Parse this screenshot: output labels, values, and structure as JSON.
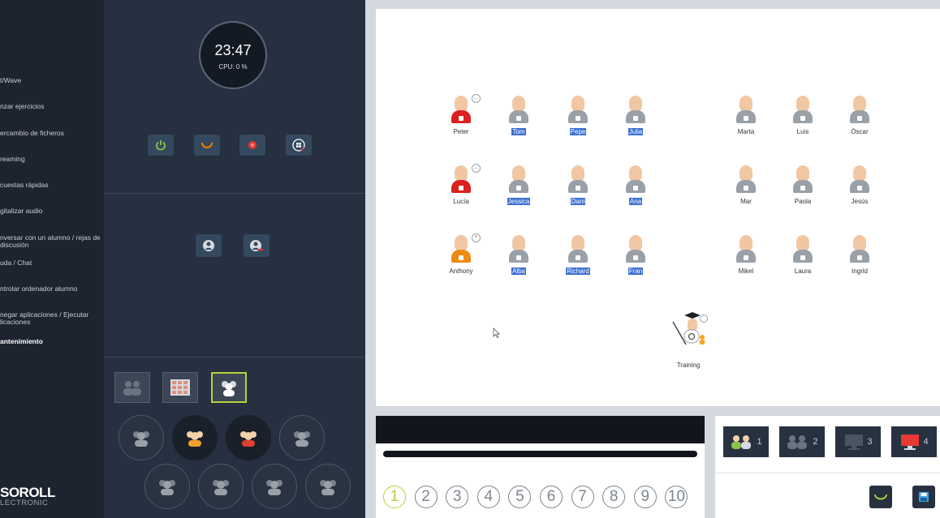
{
  "sidebar": {
    "items": [
      {
        "label": "t/Wave"
      },
      {
        "label": "nzar ejercicios"
      },
      {
        "label": "ercambio de ficheros"
      },
      {
        "label": "reaming"
      },
      {
        "label": "cuestas rápidas"
      },
      {
        "label": "gitalizar audio"
      },
      {
        "label": "nversar con un alumno / rejas de discusión"
      },
      {
        "label": "uda / Chat"
      },
      {
        "label": "ntrolar ordenador alumno"
      },
      {
        "label": "negar aplicaciones / Ejecutar licaciones"
      },
      {
        "label": "antenimiento"
      }
    ],
    "active_index": 10,
    "brand": {
      "name": "SOROLL",
      "sub": "LECTRONIC"
    }
  },
  "panel": {
    "clock": {
      "time": "23:47",
      "cpu": "CPU: 0 %"
    },
    "power_buttons": [
      {
        "icon": "power-icon",
        "color": "#8bc34a"
      },
      {
        "icon": "restart-icon",
        "color": "#f57c00"
      },
      {
        "icon": "record-stop-icon",
        "color": "#e53935"
      },
      {
        "icon": "windows-logoff-icon",
        "color": "#ffffff"
      }
    ],
    "user_buttons": [
      {
        "icon": "student-icon"
      },
      {
        "icon": "student-disconnect-icon"
      }
    ],
    "view_modes": [
      {
        "icon": "group-view-icon",
        "selected": false
      },
      {
        "icon": "grid-view-icon",
        "selected": false
      },
      {
        "icon": "class-view-icon",
        "selected": true
      }
    ],
    "group_circles_row1": [
      {
        "icon": "group-icon",
        "color": "#7a828c"
      },
      {
        "icon": "group-icon",
        "color": "#f0a030"
      },
      {
        "icon": "group-icon",
        "color": "#e04030"
      },
      {
        "icon": "group-icon",
        "color": "#7a828c"
      }
    ],
    "group_circles_row2": [
      {
        "icon": "group-icon",
        "color": "#7a828c"
      },
      {
        "icon": "group-icon",
        "color": "#7a828c"
      },
      {
        "icon": "group-icon",
        "color": "#7a828c"
      },
      {
        "icon": "group-icon",
        "color": "#7a828c"
      }
    ]
  },
  "map": {
    "students": [
      {
        "name": "Peter",
        "state": "red",
        "highlight": false,
        "bubble": "chat"
      },
      {
        "name": "Tom",
        "state": "grey",
        "highlight": true
      },
      {
        "name": "Pepe",
        "state": "grey",
        "highlight": true
      },
      {
        "name": "Julia",
        "state": "grey",
        "highlight": true
      },
      {
        "name": "Marta",
        "state": "grey",
        "highlight": false
      },
      {
        "name": "Luis",
        "state": "grey",
        "highlight": false
      },
      {
        "name": "Óscar",
        "state": "grey",
        "highlight": false
      },
      {
        "name": "Lucía",
        "state": "red",
        "highlight": false,
        "bubble": "chat"
      },
      {
        "name": "Jessica",
        "state": "grey",
        "highlight": true
      },
      {
        "name": "Dani",
        "state": "grey",
        "highlight": true
      },
      {
        "name": "Ana",
        "state": "grey",
        "highlight": true
      },
      {
        "name": "Mar",
        "state": "grey",
        "highlight": false
      },
      {
        "name": "Paola",
        "state": "grey",
        "highlight": false
      },
      {
        "name": "Jesús",
        "state": "grey",
        "highlight": false
      },
      {
        "name": "Anthony",
        "state": "orange",
        "highlight": false,
        "bubble": "close"
      },
      {
        "name": "Alba",
        "state": "grey",
        "highlight": true
      },
      {
        "name": "Richard",
        "state": "grey",
        "highlight": true
      },
      {
        "name": "Fran",
        "state": "grey",
        "highlight": true
      },
      {
        "name": "Mikel",
        "state": "grey",
        "highlight": false
      },
      {
        "name": "Laura",
        "state": "grey",
        "highlight": false
      },
      {
        "name": "Ingrid",
        "state": "grey",
        "highlight": false
      }
    ],
    "teacher": {
      "name": "Training",
      "icon": "teacher-icon"
    }
  },
  "media": {
    "channels": [
      "1",
      "2",
      "3",
      "4",
      "5",
      "6",
      "7",
      "8",
      "9",
      "10"
    ],
    "current_channel": "1"
  },
  "groups": {
    "items": [
      {
        "icon": "group-talk-icon",
        "num": "1"
      },
      {
        "icon": "group-talk-icon",
        "num": "2"
      },
      {
        "icon": "monitor-icon",
        "num": "3"
      },
      {
        "icon": "monitor-red-icon",
        "num": "4"
      }
    ],
    "actions": [
      {
        "icon": "refresh-icon"
      },
      {
        "icon": "save-icon"
      }
    ]
  }
}
